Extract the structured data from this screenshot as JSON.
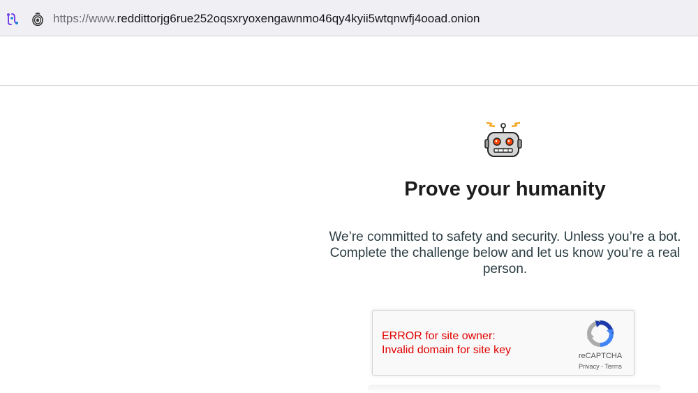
{
  "browser": {
    "url_scheme": "https://www.",
    "url_host": "reddittorjg6rue252oqsxryoxengawnmo46qy4kyii5wtqnwfj4ooad.onion",
    "icons": [
      "tor-circuit-icon",
      "onion-lock-icon"
    ]
  },
  "page": {
    "title": "Prove your humanity",
    "description": "We’re committed to safety and security. Unless you’re a bot. Complete the challenge below and let us know you’re a real person."
  },
  "recaptcha": {
    "error_line1": "ERROR for site owner:",
    "error_line2": "Invalid domain for site key",
    "brand": "reCAPTCHA",
    "privacy": "Privacy",
    "separator": " - ",
    "terms": "Terms"
  },
  "colors": {
    "error": "#e00000",
    "title": "#1c1c1c",
    "text": "#2a3c42",
    "robot_antenna": "#f5a623",
    "robot_eyes": "#ff4500",
    "recaptcha_blue": "#1c3aa9"
  }
}
